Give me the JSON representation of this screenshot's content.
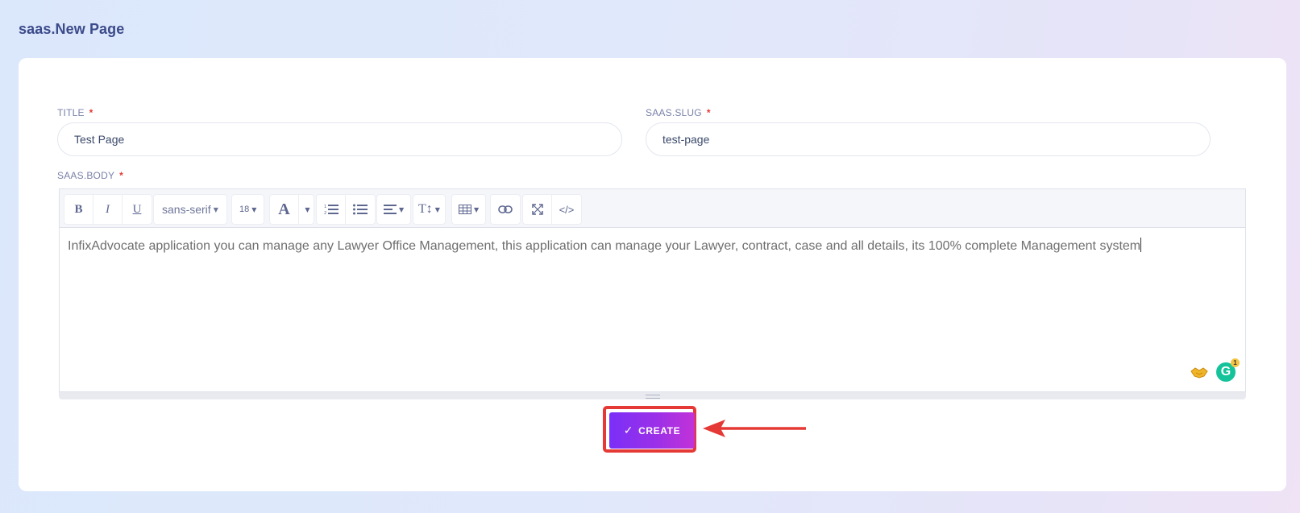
{
  "page": {
    "title": "saas.New Page"
  },
  "form": {
    "title_label": "TITLE",
    "title_value": "Test Page",
    "slug_label": "SAAS.SLUG",
    "slug_value": "test-page",
    "body_label": "SAAS.BODY",
    "required_mark": "*",
    "body_text": "InfixAdvocate application you can manage any Lawyer Office Management, this application can manage your Lawyer, contract, case and all details, its 100% complete Management system"
  },
  "toolbar": {
    "bold": "B",
    "italic": "I",
    "underline": "U",
    "font_family": "sans-serif",
    "font_size": "18",
    "color": "A",
    "ordered_list_icon": "ordered-list-icon",
    "unordered_list_icon": "unordered-list-icon",
    "align_icon": "align-icon",
    "text_height": "T↕",
    "table_icon": "table-icon",
    "link_icon": "link-icon",
    "fullscreen_icon": "fullscreen-icon",
    "code_view": "</>"
  },
  "extensions": {
    "grammarly_letter": "G",
    "grammarly_badge": "1"
  },
  "actions": {
    "create_check": "✓",
    "create_label": "CREATE"
  },
  "colors": {
    "accent_start": "#7b2ff7",
    "accent_end": "#c233d8",
    "highlight": "#e53935"
  }
}
